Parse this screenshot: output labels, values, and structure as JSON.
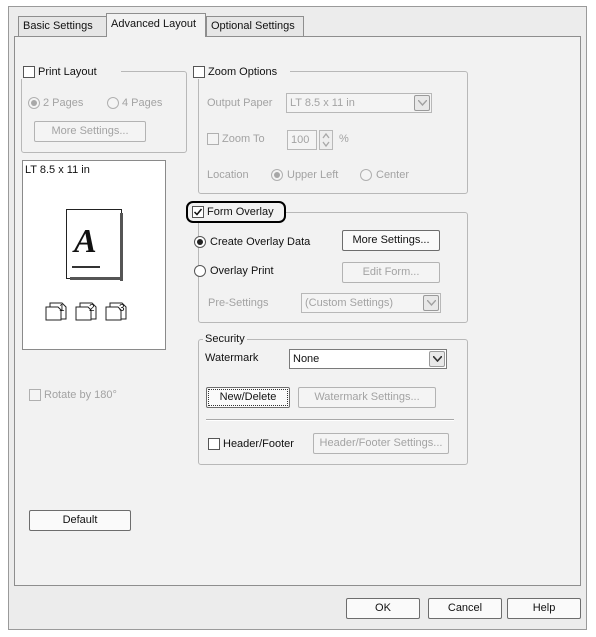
{
  "tabs": [
    {
      "label": "Basic Settings",
      "active": false
    },
    {
      "label": "Advanced Layout",
      "active": true
    },
    {
      "label": "Optional Settings",
      "active": false
    }
  ],
  "print_layout": {
    "label": "Print Layout",
    "checked": false,
    "option_2pages": "2 Pages",
    "option_4pages": "4 Pages",
    "more_settings": "More Settings..."
  },
  "preview": {
    "paper_label": "LT 8.5 x 11 in",
    "letter": "A",
    "page_numbers": [
      "1",
      "2",
      "3"
    ]
  },
  "rotate": {
    "label": "Rotate by 180°",
    "checked": false
  },
  "zoom": {
    "label": "Zoom Options",
    "checked": false,
    "output_paper_label": "Output Paper",
    "output_paper_value": "LT 8.5 x 11 in",
    "zoom_to_label": "Zoom To",
    "zoom_to_value": "100",
    "percent": "%",
    "location_label": "Location",
    "upper_left": "Upper Left",
    "center": "Center"
  },
  "form_overlay": {
    "label": "Form Overlay",
    "checked": true,
    "create_label": "Create Overlay Data",
    "more_settings": "More Settings...",
    "print_label": "Overlay Print",
    "edit_form": "Edit Form...",
    "presettings_label": "Pre-Settings",
    "presettings_value": "(Custom Settings)"
  },
  "security": {
    "legend": "Security",
    "watermark_label": "Watermark",
    "watermark_value": "None",
    "new_delete": "New/Delete",
    "watermark_settings": "Watermark Settings...",
    "header_footer_label": "Header/Footer",
    "header_footer_checked": false,
    "header_footer_settings": "Header/Footer Settings..."
  },
  "default_button": "Default",
  "footer": {
    "ok": "OK",
    "cancel": "Cancel",
    "help": "Help"
  },
  "colors": {
    "dialog_bg": "#ececec",
    "panel_bg": "#f2f2f2",
    "highlight": "#000000"
  }
}
